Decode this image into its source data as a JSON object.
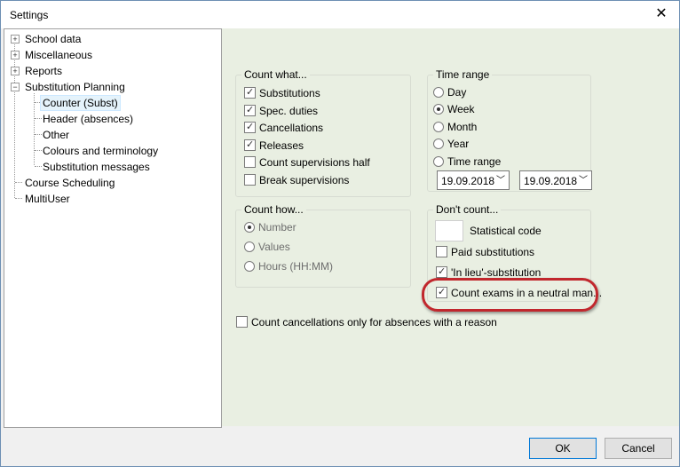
{
  "window": {
    "title": "Settings",
    "close_symbol": "✕"
  },
  "tree": {
    "items": [
      {
        "label": "School data",
        "expander": "+"
      },
      {
        "label": "Miscellaneous",
        "expander": "+"
      },
      {
        "label": "Reports",
        "expander": "+"
      },
      {
        "label": "Substitution Planning",
        "expander": "−"
      },
      {
        "label": "Counter (Subst)",
        "selected": true
      },
      {
        "label": "Header (absences)"
      },
      {
        "label": "Other"
      },
      {
        "label": "Colours and terminology"
      },
      {
        "label": "Substitution messages"
      },
      {
        "label": "Course Scheduling"
      },
      {
        "label": "MultiUser"
      }
    ]
  },
  "count_what": {
    "title": "Count what...",
    "items": [
      {
        "label": "Substitutions",
        "checked": true
      },
      {
        "label": "Spec. duties",
        "checked": true
      },
      {
        "label": "Cancellations",
        "checked": true
      },
      {
        "label": "Releases",
        "checked": true
      },
      {
        "label": "Count supervisions half",
        "checked": false
      },
      {
        "label": "Break supervisions",
        "checked": false
      }
    ]
  },
  "time_range": {
    "title": "Time range",
    "options": [
      "Day",
      "Week",
      "Month",
      "Year",
      "Time range"
    ],
    "selected": "Week",
    "from_date": "19.09.2018",
    "to_date": "19.09.2018"
  },
  "count_how": {
    "title": "Count how...",
    "options": [
      "Number",
      "Values",
      "Hours (HH:MM)"
    ],
    "selected": "Number"
  },
  "dont_count": {
    "title": "Don't count...",
    "statistical_code_label": "Statistical code",
    "paid_substitutions": {
      "label": "Paid substitutions",
      "checked": false
    },
    "in_lieu_substitution": {
      "label": "'In lieu'-substitution",
      "checked": true
    },
    "count_exams": {
      "label": "Count exams in a neutral man...",
      "checked": true
    }
  },
  "count_cancellations": {
    "label": "Count cancellations only for absences with a reason",
    "checked": false
  },
  "buttons": {
    "ok": "OK",
    "cancel": "Cancel"
  },
  "colors": {
    "highlight": "#c1272d",
    "content_bg": "#e9efe2"
  }
}
